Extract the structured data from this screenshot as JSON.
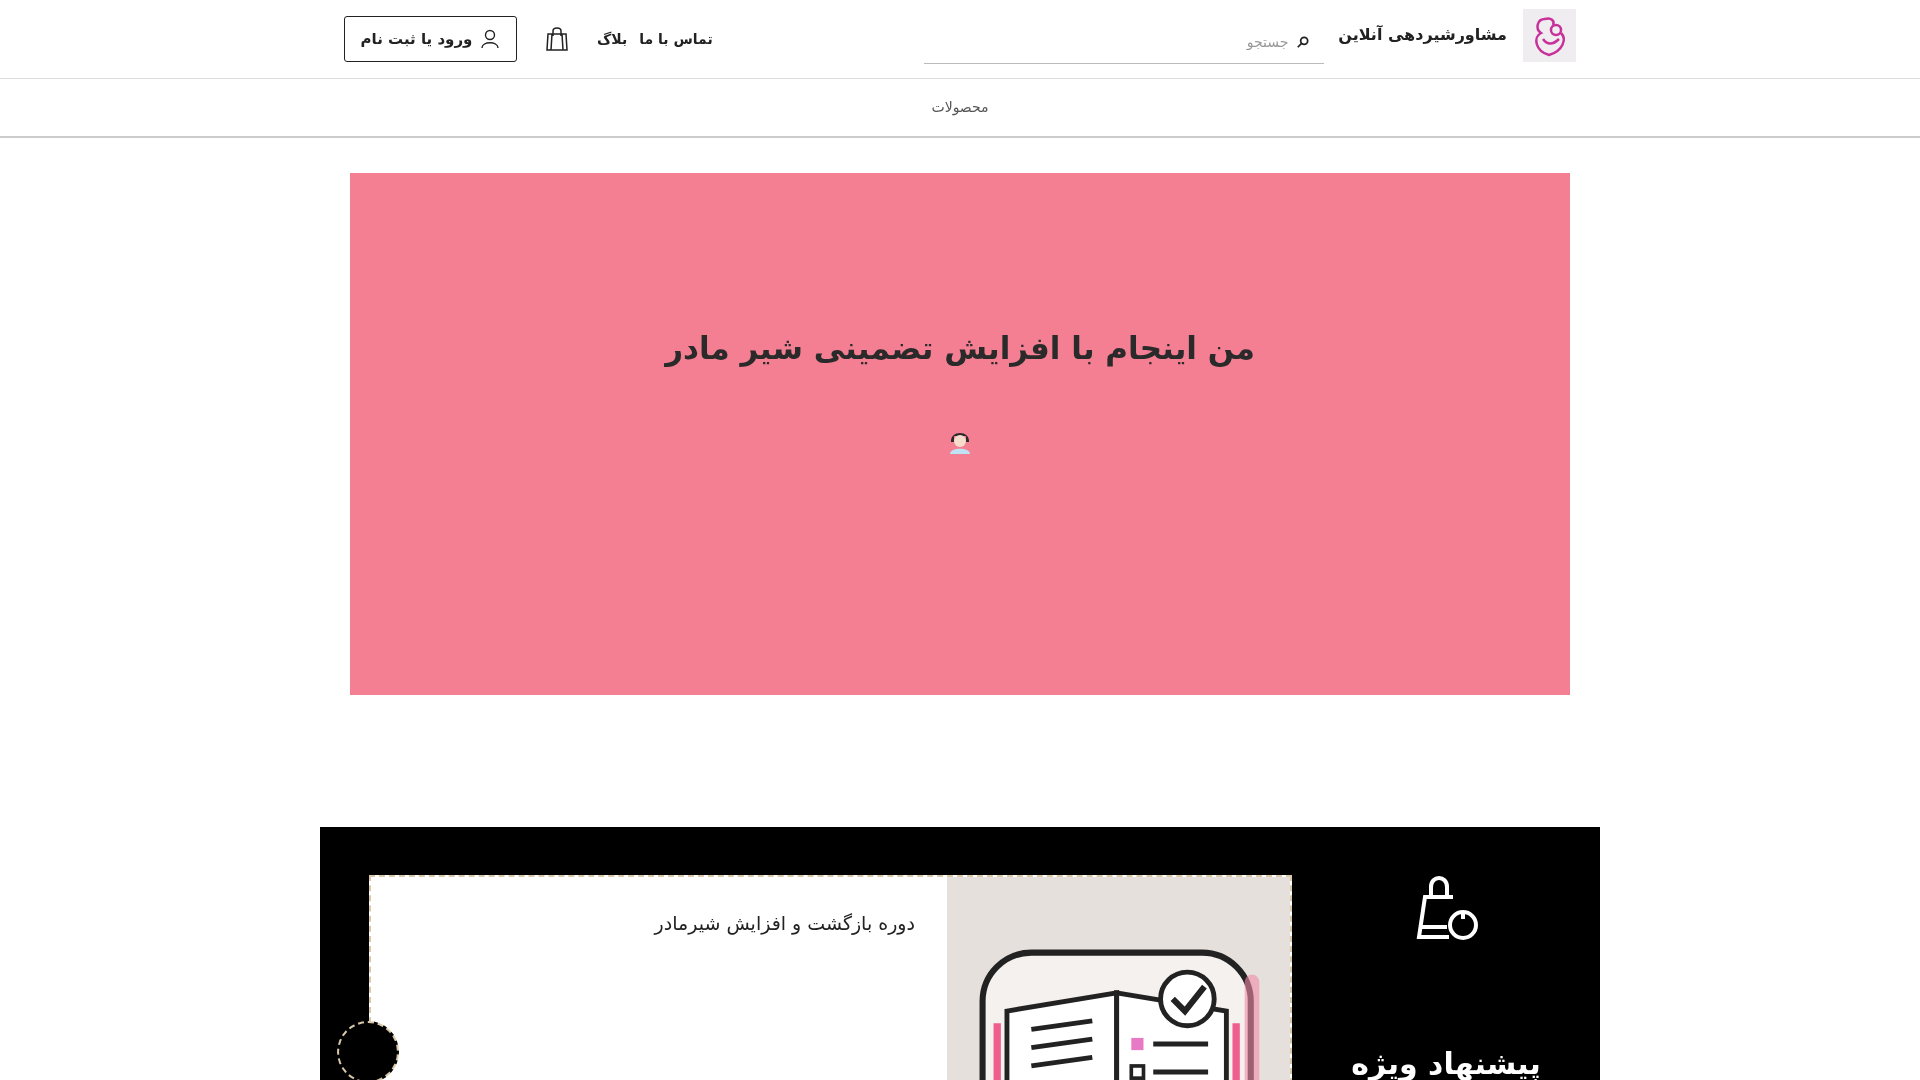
{
  "header": {
    "site_title": "مشاورشیردهی آنلاین",
    "search": {
      "placeholder": "جستجو"
    },
    "nav_links": [
      "تماس با ما",
      "بلاگ"
    ],
    "login_button": "ورود یا ثبت نام"
  },
  "menu": [
    "محصولات"
  ],
  "hero": {
    "heading": "من اینجام با افزایش تضمینی شیر مادر"
  },
  "offer": {
    "heading": "پیشنهاد ویژه",
    "card": {
      "title": "دوره بازگشت و افزایش شیرمادر"
    }
  }
}
